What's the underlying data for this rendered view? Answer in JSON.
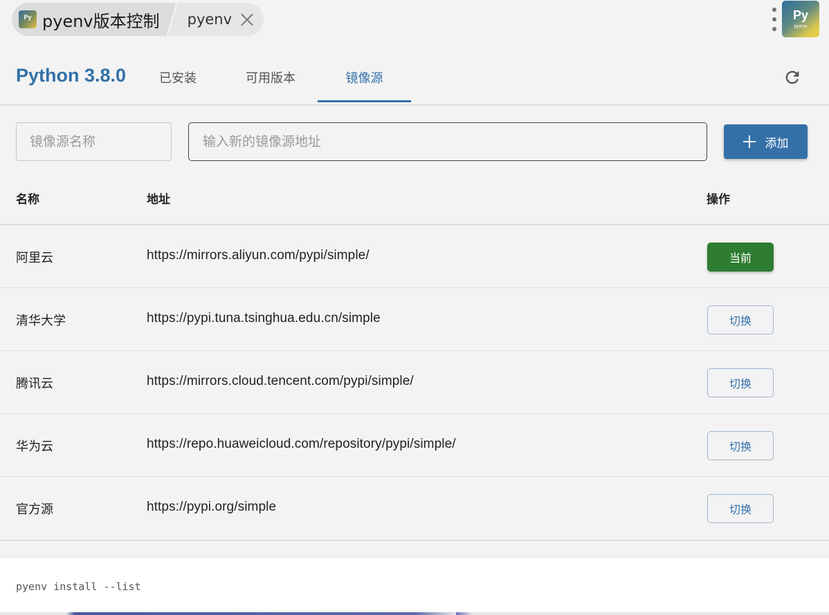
{
  "topbar": {
    "app_logo_text": "Py",
    "app_title": "pyenv版本控制",
    "tab_label": "pyenv",
    "big_logo_text": "Py",
    "big_logo_sub": "pyenv"
  },
  "header": {
    "version": "Python 3.8.0",
    "tabs": [
      {
        "label": "已安装",
        "active": false
      },
      {
        "label": "可用版本",
        "active": false
      },
      {
        "label": "镜像源",
        "active": true
      }
    ]
  },
  "add_form": {
    "name_placeholder": "镜像源名称",
    "url_placeholder": "输入新的镜像源地址",
    "add_label": "添加"
  },
  "table": {
    "columns": [
      "名称",
      "地址",
      "操作"
    ],
    "rows": [
      {
        "name": "阿里云",
        "url": "https://mirrors.aliyun.com/pypi/simple/",
        "action": "当前",
        "current": true
      },
      {
        "name": "清华大学",
        "url": "https://pypi.tuna.tsinghua.edu.cn/simple",
        "action": "切换",
        "current": false
      },
      {
        "name": "腾讯云",
        "url": "https://mirrors.cloud.tencent.com/pypi/simple/",
        "action": "切换",
        "current": false
      },
      {
        "name": "华为云",
        "url": "https://repo.huaweicloud.com/repository/pypi/simple/",
        "action": "切换",
        "current": false
      },
      {
        "name": "官方源",
        "url": "https://pypi.org/simple",
        "action": "切换",
        "current": false
      }
    ]
  },
  "command": {
    "text": "pyenv install --list"
  },
  "colors": {
    "accent": "#3470a8",
    "current_green": "#2e7d32"
  }
}
